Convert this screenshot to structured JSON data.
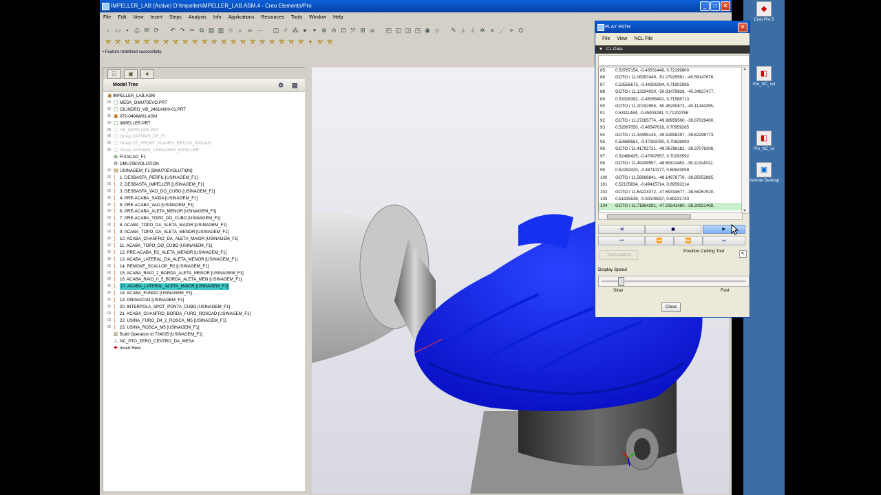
{
  "app": {
    "title": "IMPELLER_LAB (Active) D:\\Impeller\\IMPELLER_LAB.ASM.4 - Creo Elements/Pro",
    "menus": [
      "File",
      "Edit",
      "View",
      "Insert",
      "Steps",
      "Analysis",
      "Info",
      "Applications",
      "Resources",
      "Tools",
      "Window",
      "Help"
    ],
    "status_message": "• Feature redefined successfully."
  },
  "model_tree": {
    "header": "Model Tree",
    "items": [
      {
        "label": "IMPELLER_LAB.ASM",
        "kind": "root",
        "state": "normal",
        "icon": "assembly-icon"
      },
      {
        "label": "MESA_DMU70EVO.PRT",
        "kind": "part",
        "state": "normal",
        "icon": "part-icon"
      },
      {
        "label": "CILINDRO_VB_2461A000-01.PRT",
        "kind": "part",
        "state": "normal",
        "icon": "part-icon"
      },
      {
        "label": "072-0404W01.ASM",
        "kind": "part",
        "state": "normal",
        "icon": "assembly-icon"
      },
      {
        "label": "IMPELLER.PRT",
        "kind": "part",
        "state": "normal",
        "icon": "part-icon"
      },
      {
        "label": "HP_IMPELLER.PRT",
        "kind": "part",
        "state": "suppressed",
        "icon": "part-icon"
      },
      {
        "label": "Group DATUMS_OF_F1",
        "kind": "group",
        "state": "suppressed",
        "icon": "group-icon"
      },
      {
        "label": "Group ST_FRONT_PLANES_RECUO_RADIAIS",
        "kind": "group",
        "state": "suppressed",
        "icon": "group-icon"
      },
      {
        "label": "Group DATUMS_USINAGEM_IMPELLER",
        "kind": "group",
        "state": "suppressed",
        "icon": "group-icon"
      },
      {
        "label": "FIXACAO_F1",
        "kind": "fixture",
        "state": "normal",
        "icon": "fixture-icon"
      },
      {
        "label": "DMU70EVOLUTION",
        "kind": "machine",
        "state": "normal",
        "icon": "machine-icon"
      },
      {
        "label": "USINAGEM_F1 [DMU70EVOLUTION]",
        "kind": "operation",
        "state": "normal",
        "icon": "operation-icon"
      },
      {
        "label": "1. DESBASTA_PERFIL [USINAGEM_F1]",
        "kind": "step",
        "state": "normal",
        "icon": "toolpath-icon"
      },
      {
        "label": "2. DESBASTA_IMPELLER [USINAGEM_F1]",
        "kind": "step",
        "state": "normal",
        "icon": "toolpath-icon"
      },
      {
        "label": "3. DESBASTA_VAO_DO_CUBO [USINAGEM_F1]",
        "kind": "step",
        "state": "normal",
        "icon": "toolpath-icon"
      },
      {
        "label": "4. PRE-ACABA_SAIDA [USINAGEM_F1]",
        "kind": "step",
        "state": "normal",
        "icon": "toolpath-icon"
      },
      {
        "label": "5. PRE-ACABA_VAO [USINAGEM_F1]",
        "kind": "step",
        "state": "normal",
        "icon": "toolpath-icon"
      },
      {
        "label": "6. PRE-ACABA_ALETA_MENOR [USINAGEM_F1]",
        "kind": "step",
        "state": "normal",
        "icon": "toolpath-icon"
      },
      {
        "label": "7. PRE-ACABA_TOPO_DO_CUBO [USINAGEM_F1]",
        "kind": "step",
        "state": "normal",
        "icon": "toolpath-icon"
      },
      {
        "label": "8. ACABA_TOPO_DA_ALETA_MAIOR [USINAGEM_F1]",
        "kind": "step",
        "state": "normal",
        "icon": "toolpath-icon"
      },
      {
        "label": "9. ACABA_TOPO_DA_ALETA_MENOR [USINAGEM_F1]",
        "kind": "step",
        "state": "normal",
        "icon": "toolpath-icon"
      },
      {
        "label": "10. ACABA_CHANFRO_DA_ALETA_MAIOR [USINAGEM_F1]",
        "kind": "step",
        "state": "normal",
        "icon": "toolpath-icon"
      },
      {
        "label": "11. ACABA_TOPO_DO_CUBO [USINAGEM_F1]",
        "kind": "step",
        "state": "normal",
        "icon": "toolpath-icon"
      },
      {
        "label": "12. PRE-ACABA_R2_ALETA_MENOR [USINAGEM_F1]",
        "kind": "step",
        "state": "normal",
        "icon": "toolpath-icon"
      },
      {
        "label": "13. ACABA_LATERAL_DA_ALETA_MENOR [USINAGEM_F1]",
        "kind": "step",
        "state": "normal",
        "icon": "toolpath-icon"
      },
      {
        "label": "14. REMOVE_SCALLOP_R2 [USINAGEM_F1]",
        "kind": "step",
        "state": "normal",
        "icon": "toolpath-icon"
      },
      {
        "label": "15. ACABA_RAIO_2_BORDA_ALETA_MENOR [USINAGEM_F1]",
        "kind": "step",
        "state": "normal",
        "icon": "toolpath-icon"
      },
      {
        "label": "16. ACABA_RAIO_0_5_BORDA_ALETA_MEN [USINAGEM_F1]",
        "kind": "step",
        "state": "normal",
        "icon": "toolpath-icon"
      },
      {
        "label": "17. ACABA_LATERAL_ALETA_MAIOR [USINAGEM_F1]",
        "kind": "step",
        "state": "selected",
        "icon": "toolpath-icon"
      },
      {
        "label": "18. ACABA_FUNDO [USINAGEM_F1]",
        "kind": "step",
        "state": "normal",
        "icon": "toolpath-icon"
      },
      {
        "label": "19. GRAVACAO [USINAGEM_F1]",
        "kind": "step",
        "state": "normal",
        "icon": "toolpath-icon"
      },
      {
        "label": "20. INTERPOLA_SPOT_PONTA_CUBO [USINAGEM_F1]",
        "kind": "step",
        "state": "normal",
        "icon": "toolpath-icon"
      },
      {
        "label": "21. ACABA_CHANFRO_BORDA_FURO_ROSCAD [USINAGEM_F1]",
        "kind": "step",
        "state": "normal",
        "icon": "toolpath-icon"
      },
      {
        "label": "22. USINA_FURO_D4_2_ROSCA_M5 [USINAGEM_F1]",
        "kind": "step",
        "state": "normal",
        "icon": "toolpath-icon"
      },
      {
        "label": "23. USINA_ROSCA_M5 [USINAGEM_F1]",
        "kind": "step",
        "state": "normal",
        "icon": "toolpath-icon"
      },
      {
        "label": "Build Operation id 724035 [USINAGEM_F1]",
        "kind": "misc",
        "state": "normal",
        "icon": "build-icon"
      },
      {
        "label": "NC_PTO_ZERO_CENTRO_DA_MESA",
        "kind": "misc",
        "state": "normal",
        "icon": "csys-icon"
      },
      {
        "label": "Insert Here",
        "kind": "insert",
        "state": "normal",
        "icon": "insert-here-icon"
      }
    ]
  },
  "play_path": {
    "title": "PLAY PATH",
    "menus": [
      "File",
      "View",
      "NCL File"
    ],
    "section": "CL Data",
    "lines": [
      {
        "n": "85",
        "text": "0.53787154, -0.43531448, 0.72199800"
      },
      {
        "n": "86",
        "text": "GOTO / 11.06397449, -51.27925591, -40.58147676,"
      },
      {
        "n": "87",
        "text": "0.53556673, -0.44281084, 0.71902595"
      },
      {
        "n": "88",
        "text": "GOTO / 11.13194020, -50.91479826, -40.34927477,"
      },
      {
        "n": "89",
        "text": "0.53328392, -0.45065491, 0.71588713"
      },
      {
        "n": "90",
        "text": "GOTO / 11.20192955, -50.45200873, -40.11244295,"
      },
      {
        "n": "91",
        "text": "0.53111484, -0.45903281, 0.71202758"
      },
      {
        "n": "92",
        "text": "GOTO / 11.27285774, -49.98959500, -39.87029400,"
      },
      {
        "n": "93",
        "text": "0.52897050, -0.46547616, 0.70959265"
      },
      {
        "n": "94",
        "text": "GOTO / 11.34495144, -49.52808297, -39.62298773,"
      },
      {
        "n": "95",
        "text": "0.52688561, -0.47283780, 0.70626093"
      },
      {
        "n": "96",
        "text": "GOTO / 11.41792721, -49.06786182, -39.37078306,"
      },
      {
        "n": "97",
        "text": "0.52488435, -0.47997657, 0.70293592"
      },
      {
        "n": "98",
        "text": "GOTO / 11.49199557, -48.60811463, -39.11314312,"
      },
      {
        "n": "99",
        "text": "0.52292420, -0.48710277, 0.69943059"
      },
      {
        "n": "100",
        "text": "GOTO / 11.56686841, -48.14978776, -38.85052885,"
      },
      {
        "n": "101",
        "text": "0.52105834, -0.49415714, 0.69592214"
      },
      {
        "n": "102",
        "text": "GOTO / 11.64223372, -47.69334677, -38.58267520,"
      },
      {
        "n": "103",
        "text": "0.51925538, -0.50106937, 0.69231743"
      },
      {
        "n": "104",
        "text": "GOTO / 11.71864281, -47.23541460, -38.30921408,"
      }
    ],
    "highlighted_line": "104",
    "tool_location_label": "Tool Location",
    "position_cutting_tool_label": "Position Cutting Tool",
    "display_speed_label": "Display Speed",
    "speed_slow_label": "Slow",
    "speed_fast_label": "Fast",
    "close_label": "Close",
    "display_speed_level": 0.12
  },
  "desktop": {
    "icons": [
      "Creo Pro 5",
      "Pro_NC_sol",
      "Pro_NC_vc",
      "Remote Desktop"
    ]
  },
  "colors": {
    "accent_blue": "#0a5fd8",
    "impeller_blue": "#0a1fe8",
    "selection": "#3fc9c9",
    "highlight_line": "#caf0cb"
  }
}
